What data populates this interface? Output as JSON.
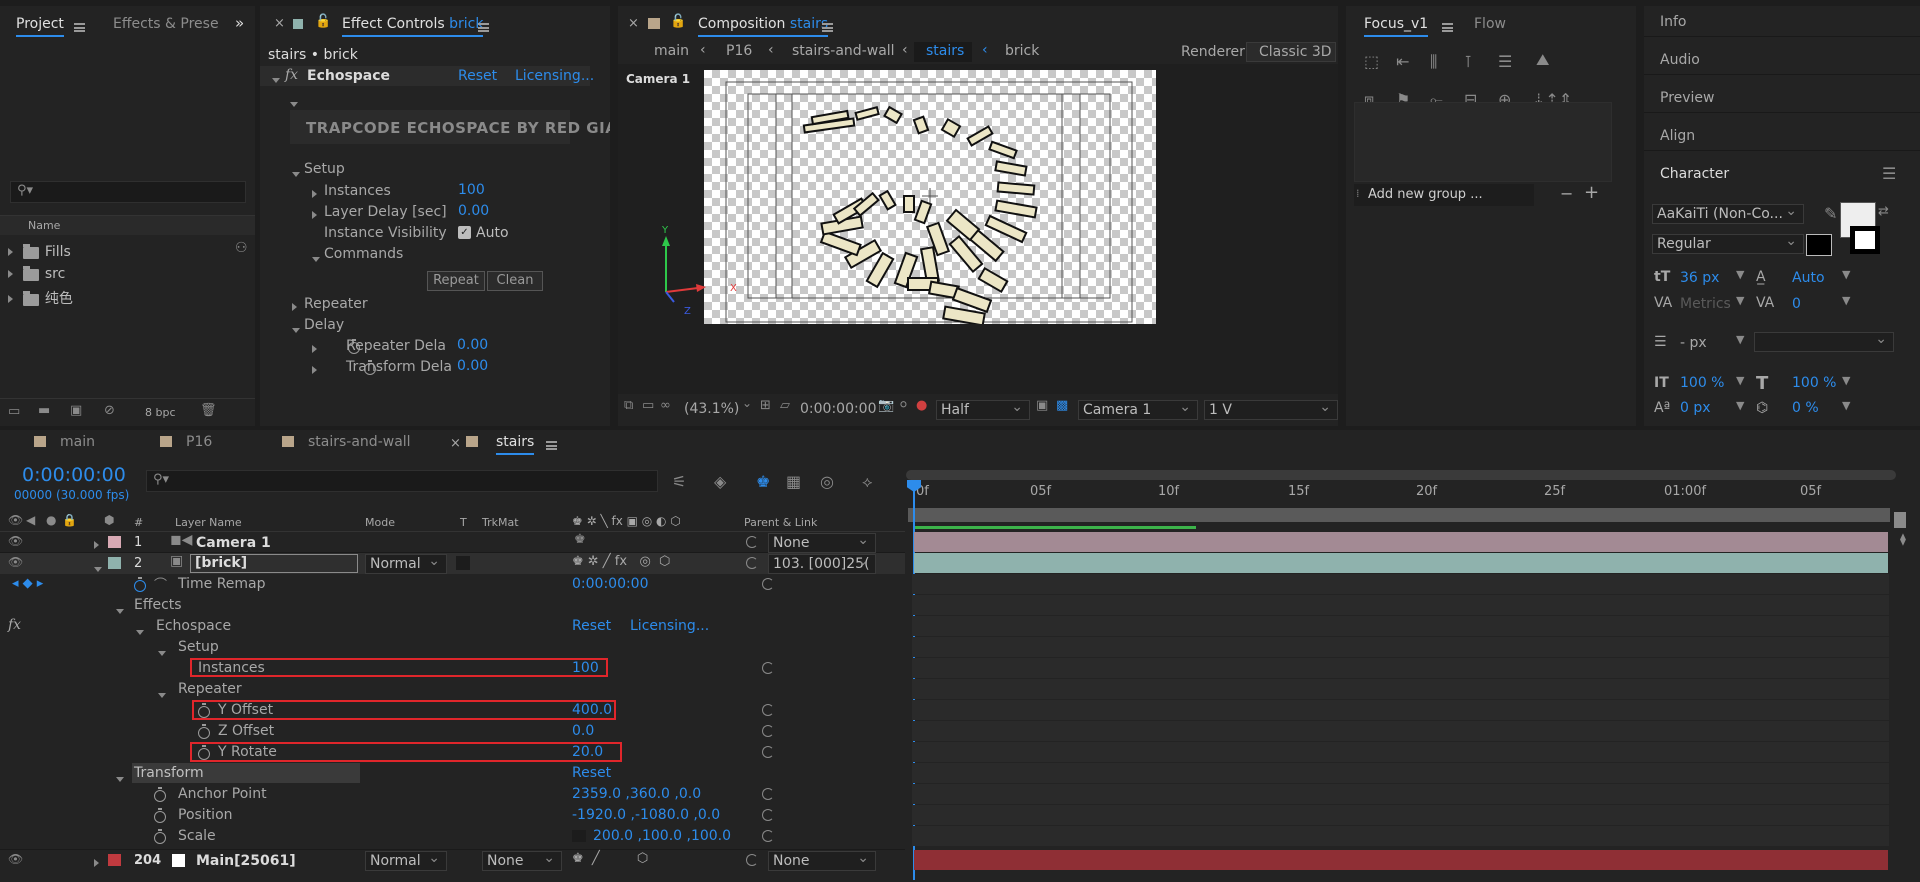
{
  "project_panel": {
    "tabs": [
      "Project",
      "Effects & Prese"
    ],
    "column_name": "Name",
    "items": [
      "Fills",
      "src",
      "纯色"
    ],
    "bpc": "8 bpc"
  },
  "effect_controls": {
    "tab_prefix": "Effect Controls",
    "tab_layer": "brick",
    "breadcrumb": "stairs • brick",
    "effect_name": "Echospace",
    "reset": "Reset",
    "licensing": "Licensing...",
    "banner": "TRAPCODE ECHOSPACE BY RED GIAI",
    "setup": "Setup",
    "instances_label": "Instances",
    "instances_value": "100",
    "layer_delay_label": "Layer Delay [sec]",
    "layer_delay_value": "0.00",
    "visibility_label": "Instance Visibility",
    "visibility_value": "Auto",
    "commands": "Commands",
    "repeat_btn": "Repeat",
    "clean_btn": "Clean",
    "repeater": "Repeater",
    "delay": "Delay",
    "repeater_delay_label": "Repeater Dela",
    "repeater_delay_value": "0.00",
    "transform_delay_label": "Transform Dela",
    "transform_delay_value": "0.00"
  },
  "composition": {
    "tab_prefix": "Composition",
    "tab_name": "stairs",
    "breadcrumbs": [
      "main",
      "P16",
      "stairs-and-wall",
      "stairs",
      "brick"
    ],
    "renderer_label": "Renderer:",
    "renderer_value": "Classic 3D",
    "camera_label": "Camera 1",
    "zoom": "(43.1%)",
    "timecode": "0:00:00:00",
    "resolution": "Half",
    "view": "Camera 1",
    "views": "1 V",
    "axis_x": "X",
    "axis_y": "Y",
    "axis_z": "Z"
  },
  "focus_panel": {
    "tabs": [
      "Focus_v1",
      "Flow"
    ],
    "add_group_placeholder": "Add new group ..."
  },
  "right_panel": {
    "items": [
      "Info",
      "Audio",
      "Preview",
      "Align"
    ],
    "character_title": "Character",
    "font": "AaKaiTi (Non-Co...",
    "style": "Regular",
    "font_size": "36 px",
    "leading": "Auto",
    "kerning": "Metrics",
    "tracking": "0",
    "stroke": "- px",
    "v_scale": "100 %",
    "h_scale": "100 %",
    "baseline": "0 px",
    "tsume": "0 %"
  },
  "timeline": {
    "tabs": [
      "main",
      "P16",
      "stairs-and-wall",
      "stairs"
    ],
    "timecode": "0:00:00:00",
    "frames": "00000 (30.000 fps)",
    "search_placeholder": "",
    "col_layer_name": "Layer Name",
    "col_mode": "Mode",
    "col_t": "T",
    "col_trkmat": "TrkMat",
    "col_parent": "Parent & Link",
    "col_num": "#",
    "ruler": [
      "0f",
      "05f",
      "10f",
      "15f",
      "20f",
      "25f",
      "01:00f",
      "05f"
    ],
    "layers": {
      "l1_num": "1",
      "l1_name": "Camera 1",
      "l1_parent": "None",
      "l2_num": "2",
      "l2_name": "[brick]",
      "l2_mode": "Normal",
      "l2_parent": "103. [000]25(",
      "l204_num": "204",
      "l204_name": "Main[25061]",
      "l204_mode": "Normal",
      "l204_trkmat": "None",
      "l204_parent": "None"
    },
    "props": {
      "time_remap": "Time Remap",
      "time_remap_value": "0:00:00:00",
      "effects": "Effects",
      "echospace": "Echospace",
      "reset": "Reset",
      "licensing": "Licensing...",
      "setup": "Setup",
      "instances": "Instances",
      "instances_value": "100",
      "repeater": "Repeater",
      "y_offset": "Y Offset",
      "y_offset_value": "400.0",
      "z_offset": "Z Offset",
      "z_offset_value": "0.0",
      "y_rotate": "Y Rotate",
      "y_rotate_value": "20.0",
      "transform": "Transform",
      "transform_reset": "Reset",
      "anchor": "Anchor Point",
      "anchor_value": "2359.0 ,360.0 ,0.0",
      "position": "Position",
      "position_value": "-1920.0 ,-1080.0 ,0.0",
      "scale": "Scale",
      "scale_value": "200.0 ,100.0 ,100.0"
    }
  },
  "colors": {
    "accent_blue": "#2d8ceb",
    "highlight_red": "#e0262b",
    "camera_bar": "#a38a94",
    "brick_bar": "#8fb2ad",
    "main_bar": "#8f2f35"
  }
}
